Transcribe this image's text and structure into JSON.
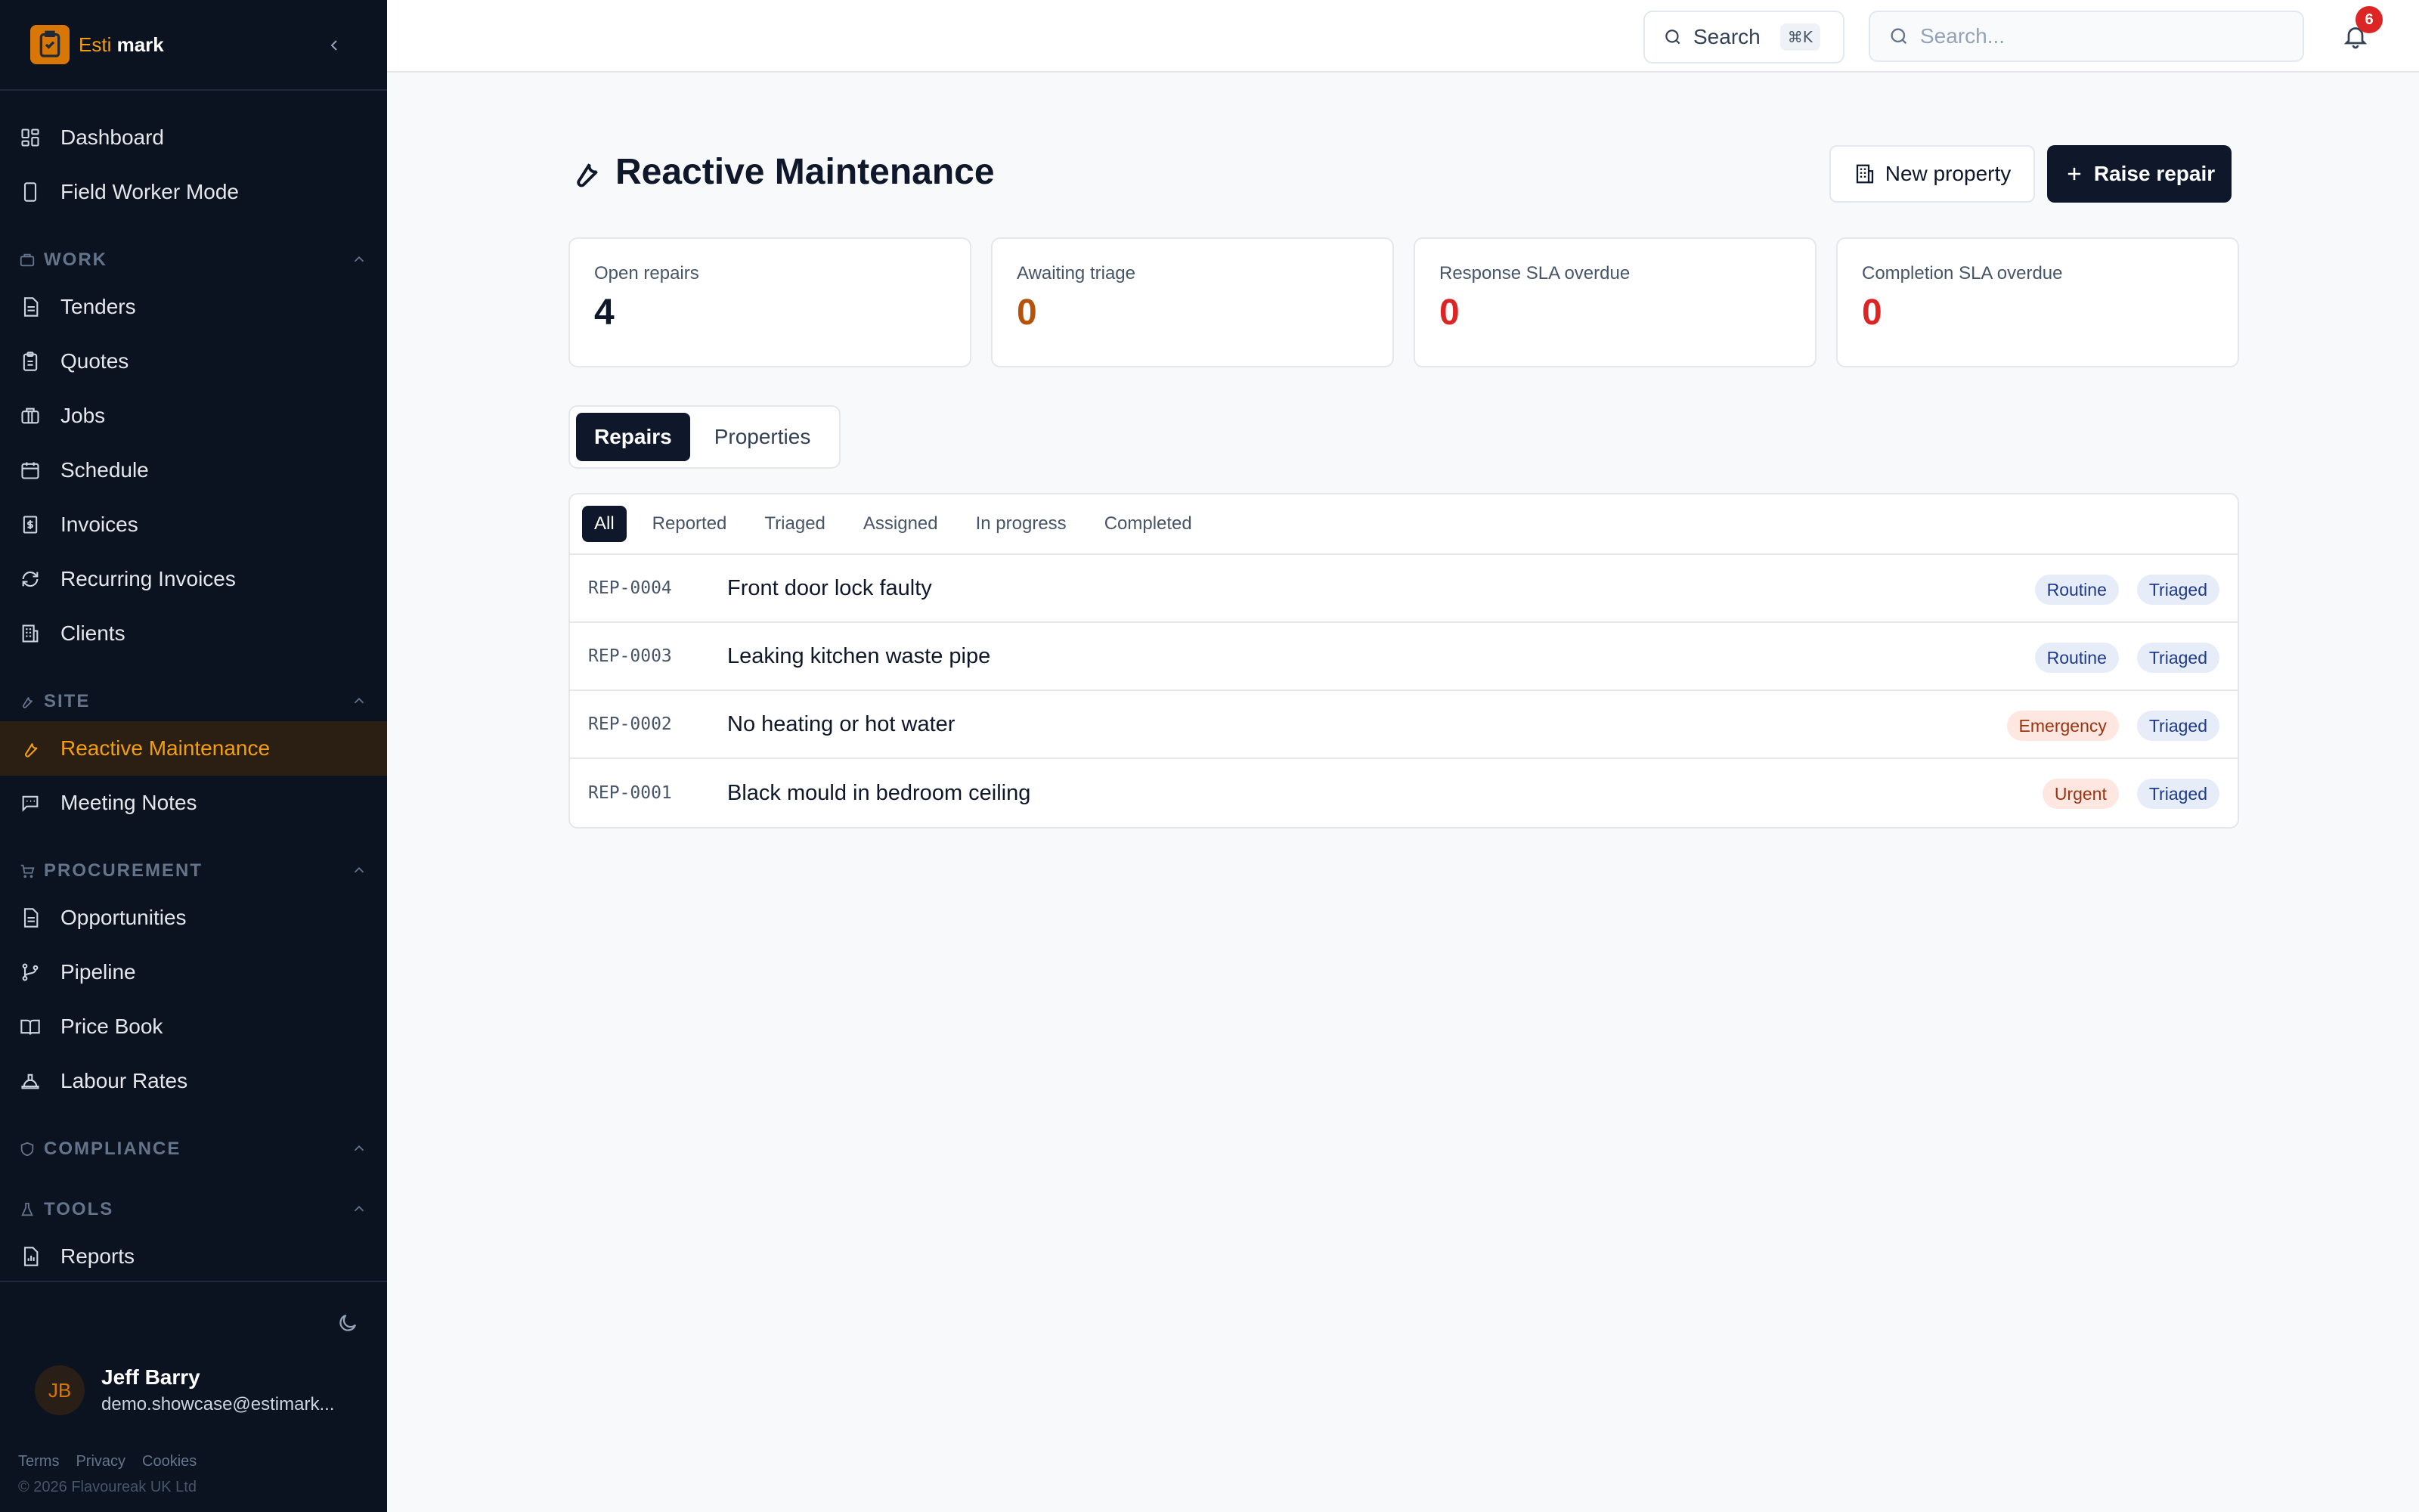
{
  "app": {
    "logo_part1": "Esti",
    "logo_part2": "mark"
  },
  "sidebar": {
    "top_items": [
      {
        "label": "Dashboard",
        "icon": "grid-icon"
      },
      {
        "label": "Field Worker Mode",
        "icon": "phone-icon"
      }
    ],
    "sections": {
      "work": {
        "label": "WORK",
        "icon": "briefcase-icon"
      },
      "site": {
        "label": "SITE",
        "icon": "wrench-icon"
      },
      "procurement": {
        "label": "PROCUREMENT",
        "icon": "cart-icon"
      },
      "compliance": {
        "label": "COMPLIANCE",
        "icon": "shield-icon"
      },
      "tools": {
        "label": "TOOLS",
        "icon": "flask-icon"
      }
    },
    "work_items": [
      {
        "label": "Tenders",
        "icon": "document-icon"
      },
      {
        "label": "Quotes",
        "icon": "clipboard-icon"
      },
      {
        "label": "Jobs",
        "icon": "briefcase-icon"
      },
      {
        "label": "Schedule",
        "icon": "calendar-icon"
      },
      {
        "label": "Invoices",
        "icon": "invoice-icon"
      },
      {
        "label": "Recurring Invoices",
        "icon": "refresh-icon"
      },
      {
        "label": "Clients",
        "icon": "building-icon"
      }
    ],
    "site_items": [
      {
        "label": "Reactive Maintenance",
        "icon": "wrench-icon",
        "active": true
      },
      {
        "label": "Meeting Notes",
        "icon": "chat-icon"
      }
    ],
    "procurement_items": [
      {
        "label": "Opportunities",
        "icon": "document-icon"
      },
      {
        "label": "Pipeline",
        "icon": "branch-icon"
      },
      {
        "label": "Price Book",
        "icon": "book-icon"
      },
      {
        "label": "Labour Rates",
        "icon": "hard-hat-icon"
      }
    ],
    "tools_items": [
      {
        "label": "Reports",
        "icon": "report-icon"
      }
    ],
    "user": {
      "initials": "JB",
      "name": "Jeff Barry",
      "email": "demo.showcase@estimark..."
    },
    "footer": {
      "terms": "Terms",
      "privacy": "Privacy",
      "cookies": "Cookies",
      "copyright": "© 2026 Flavoureak UK Ltd"
    }
  },
  "topbar": {
    "search_label": "Search",
    "search_shortcut": "⌘K",
    "search_placeholder": "Search...",
    "notification_count": "6"
  },
  "page": {
    "title": "Reactive Maintenance",
    "new_property_label": "New property",
    "raise_repair_label": "Raise repair"
  },
  "stats": [
    {
      "label": "Open repairs",
      "value": "4",
      "color": "#0f172a"
    },
    {
      "label": "Awaiting triage",
      "value": "0",
      "color": "#b45309"
    },
    {
      "label": "Response SLA overdue",
      "value": "0",
      "color": "#dc2626"
    },
    {
      "label": "Completion SLA overdue",
      "value": "0",
      "color": "#dc2626"
    }
  ],
  "tabs": [
    {
      "label": "Repairs",
      "active": true
    },
    {
      "label": "Properties",
      "active": false
    }
  ],
  "filters": [
    {
      "label": "All",
      "active": true
    },
    {
      "label": "Reported"
    },
    {
      "label": "Triaged"
    },
    {
      "label": "Assigned"
    },
    {
      "label": "In progress"
    },
    {
      "label": "Completed"
    }
  ],
  "repairs": [
    {
      "ref": "REP-0004",
      "title": "Front door lock faulty",
      "priority": "Routine",
      "status": "Triaged"
    },
    {
      "ref": "REP-0003",
      "title": "Leaking kitchen waste pipe",
      "priority": "Routine",
      "status": "Triaged"
    },
    {
      "ref": "REP-0002",
      "title": "No heating or hot water",
      "priority": "Emergency",
      "status": "Triaged"
    },
    {
      "ref": "REP-0001",
      "title": "Black mould in bedroom ceiling",
      "priority": "Urgent",
      "status": "Triaged"
    }
  ],
  "colors": {
    "sidebar_bg": "#0b1220",
    "accent": "#f59e0b",
    "danger": "#dc2626",
    "primary_dark": "#0f172a"
  }
}
